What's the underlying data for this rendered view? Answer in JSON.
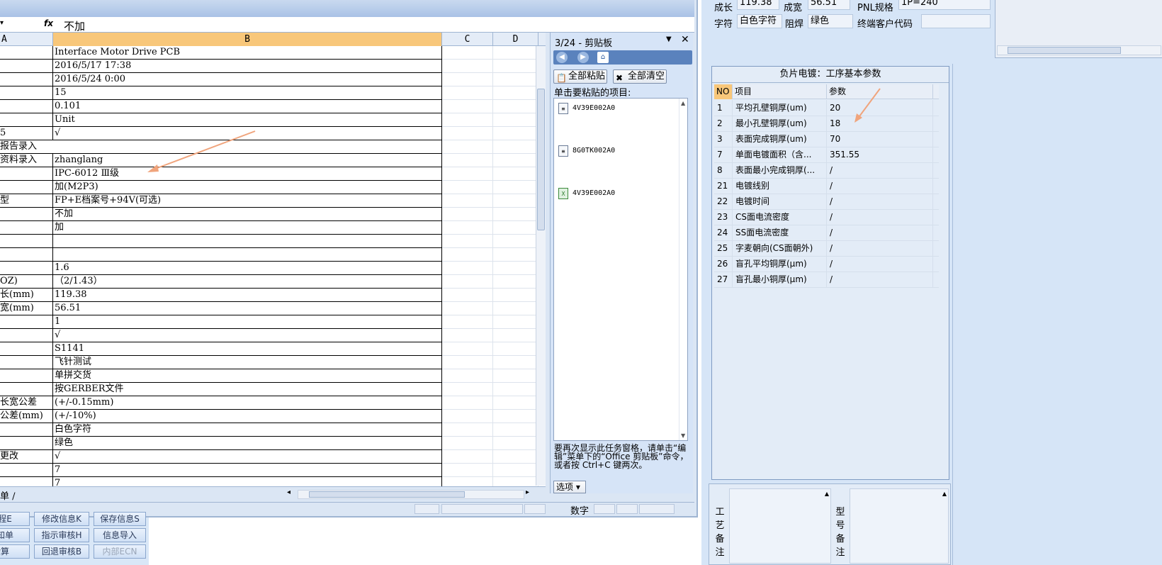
{
  "excel": {
    "formula_value": "不加",
    "fx_label": "fx",
    "columns": [
      "A",
      "B",
      "C",
      "D"
    ],
    "rows": [
      {
        "a": "",
        "b": "Interface Motor Drive PCB"
      },
      {
        "a": "",
        "b": "2016/5/17 17:38"
      },
      {
        "a": "",
        "b": "2016/5/24 0:00"
      },
      {
        "a": "",
        "b": "15"
      },
      {
        "a": "",
        "b": "0.101"
      },
      {
        "a": "",
        "b": "Unit"
      },
      {
        "a": "5",
        "b": "√"
      },
      {
        "a": "报告录入",
        "b": "",
        "span": true
      },
      {
        "a": "资料录入",
        "b": "zhanglang"
      },
      {
        "a": "",
        "b": "IPC-6012 Ⅲ级"
      },
      {
        "a": "",
        "b": "加(M2P3)"
      },
      {
        "a": "型",
        "b": "FP+E档案号+94V(可选)"
      },
      {
        "a": "",
        "b": "不加"
      },
      {
        "a": "",
        "b": "加"
      },
      {
        "a": "",
        "b": ""
      },
      {
        "a": "",
        "b": ""
      },
      {
        "a": "",
        "b": "1.6"
      },
      {
        "a": "OZ)",
        "b": "（2/1.43）"
      },
      {
        "a": "长(mm)",
        "b": "119.38"
      },
      {
        "a": "宽(mm)",
        "b": "56.51"
      },
      {
        "a": "",
        "b": "1"
      },
      {
        "a": "",
        "b": "√"
      },
      {
        "a": "",
        "b": "S1141"
      },
      {
        "a": "",
        "b": "飞针测试"
      },
      {
        "a": "",
        "b": "单拼交货"
      },
      {
        "a": "",
        "b": "按GERBER文件"
      },
      {
        "a": "长宽公差",
        "b": "(+/-0.15mm)"
      },
      {
        "a": "公差(mm)",
        "b": "(+/-10%)"
      },
      {
        "a": "",
        "b": "白色字符"
      },
      {
        "a": "",
        "b": "绿色"
      },
      {
        "a": "更改",
        "b": "√"
      },
      {
        "a": "",
        "b": "7"
      },
      {
        "a": "",
        "b": "7"
      }
    ],
    "sheet_tab": "单",
    "status_mode": "数字"
  },
  "clipboard": {
    "title": "3/24 - 剪贴板",
    "paste_all": "全部粘贴",
    "clear_all": "全部清空",
    "hint": "单击要粘贴的项目:",
    "items": [
      {
        "label": "4V39E002A0",
        "type": "doc"
      },
      {
        "label": "8G0TK002A0",
        "type": "doc"
      },
      {
        "label": "4V39E002A0",
        "type": "xls"
      }
    ],
    "footer": "要再次显示此任务窗格，请单击“编辑”菜单下的“Office 剪贴板”命令，或者按 Ctrl+C 键两次。",
    "options": "选项"
  },
  "bottom_left_buttons": [
    [
      "流程E",
      "修改信息K",
      "保存信息S"
    ],
    [
      "通知单",
      "指示审核H",
      "信息导入"
    ],
    [
      "验算",
      "回退审核B",
      "内部ECN"
    ]
  ],
  "right_app": {
    "fields_top": {
      "len_label": "成长",
      "len_value": "119.38",
      "wid_label": "成宽",
      "wid_value": "56.51",
      "pnl_label": "PNL规格",
      "pnl_value": "1P=240"
    },
    "fields_row2": {
      "char_label": "字符",
      "char_value": "白色字符",
      "mask_label": "阻焊",
      "mask_value": "绿色",
      "cust_label": "终端客户代码",
      "cust_value": ""
    },
    "param_panel": {
      "title": "负片电镀：工序基本参数",
      "headers": [
        "NO",
        "项目",
        "参数"
      ],
      "rows": [
        {
          "no": "1",
          "item": "平均孔壁铜厚(um)",
          "value": "20"
        },
        {
          "no": "2",
          "item": "最小孔壁铜厚(um)",
          "value": "18"
        },
        {
          "no": "3",
          "item": "表面完成铜厚(um)",
          "value": "70"
        },
        {
          "no": "7",
          "item": "单面电镀面积（含...",
          "value": "351.55"
        },
        {
          "no": "8",
          "item": "表面最小完成铜厚(...",
          "value": "/"
        },
        {
          "no": "21",
          "item": "电镀线别",
          "value": "/"
        },
        {
          "no": "22",
          "item": "电镀时间",
          "value": "/"
        },
        {
          "no": "23",
          "item": "CS面电流密度",
          "value": "/"
        },
        {
          "no": "24",
          "item": "SS面电流密度",
          "value": "/"
        },
        {
          "no": "25",
          "item": "字麦朝向(CS面朝外)",
          "value": "/"
        },
        {
          "no": "26",
          "item": "盲孔平均铜厚(μm)",
          "value": "/"
        },
        {
          "no": "27",
          "item": "盲孔最小铜厚(μm)",
          "value": "/"
        }
      ]
    },
    "notes": {
      "process_label": [
        "工",
        "艺",
        "备",
        "注"
      ],
      "model_label": [
        "型",
        "号",
        "备",
        "注"
      ]
    }
  },
  "colors": {
    "selected_header": "#f8c77a",
    "annotation_arrow": "#f0a47c"
  }
}
